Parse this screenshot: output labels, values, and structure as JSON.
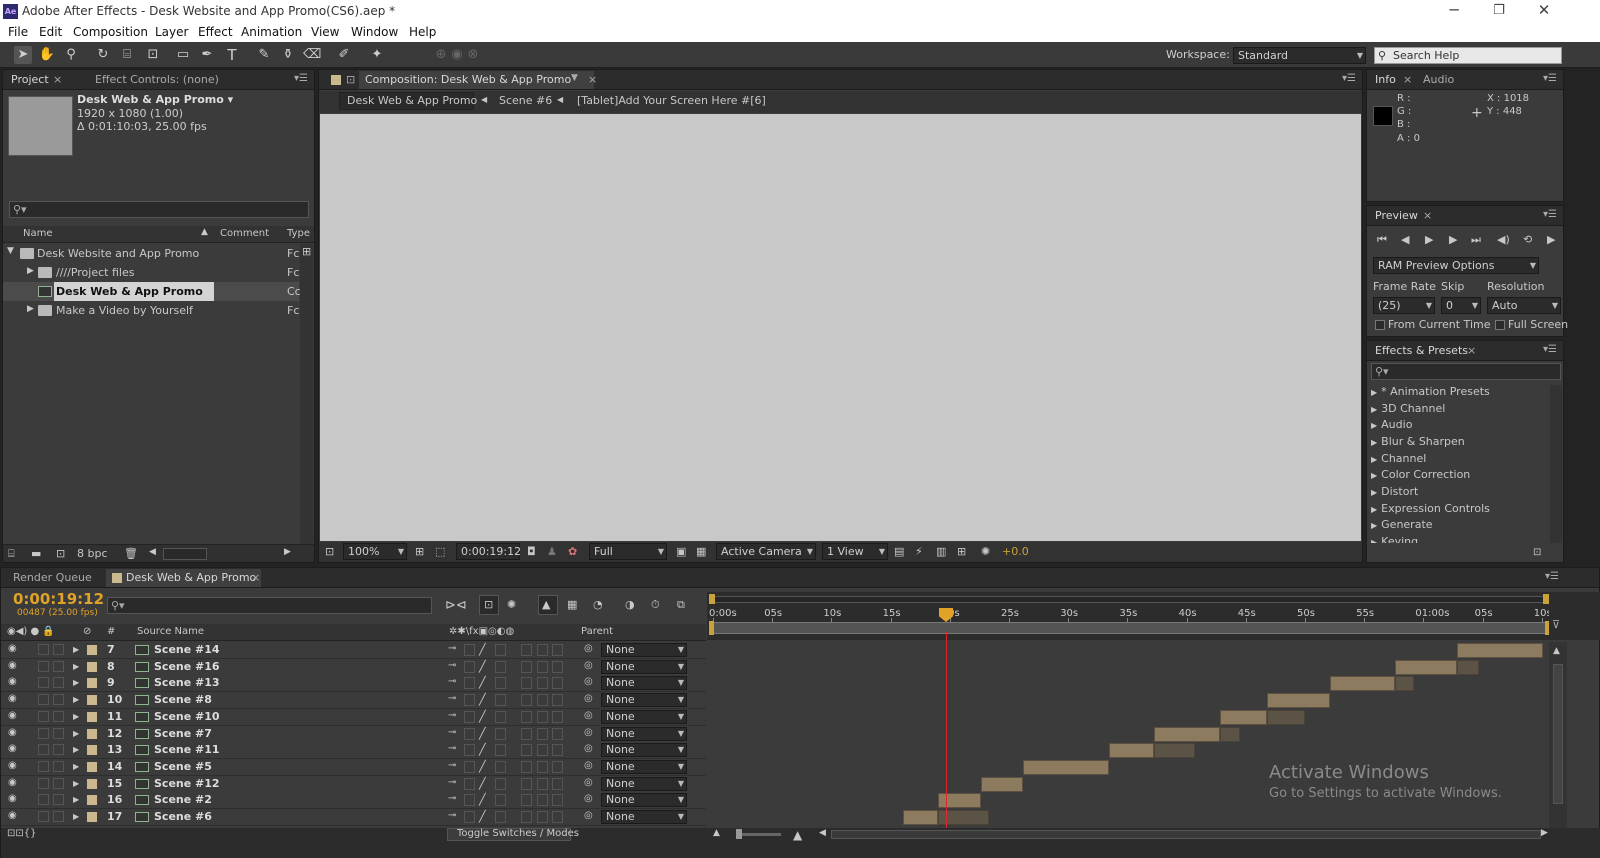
{
  "window": {
    "title": "Adobe After Effects - Desk Website and App Promo(CS6).aep *",
    "logo": "Ae",
    "minimize": "─",
    "maximize": "❐",
    "close": "✕"
  },
  "menu": [
    "File",
    "Edit",
    "Composition",
    "Layer",
    "Effect",
    "Animation",
    "View",
    "Window",
    "Help"
  ],
  "toolbar": {
    "workspace_label": "Workspace:",
    "workspace_value": "Standard",
    "search_help_placeholder": "Search Help"
  },
  "project": {
    "tab_project": "Project",
    "tab_effect_controls": "Effect Controls: (none)",
    "comp_name": "Desk Web & App Promo ▾",
    "comp_size": "1920 x 1080 (1.00)",
    "comp_duration": "Δ 0:01:10:03, 25.00 fps",
    "search_placeholder": "⚲▾",
    "col_name": "Name",
    "col_comment": "Comment",
    "col_type": "Type",
    "items": [
      {
        "name": "Desk Website and App Promo",
        "type": "Fc"
      },
      {
        "name": "////Project files",
        "type": "Fc"
      },
      {
        "name": "Desk Web & App Promo",
        "type": "Cc"
      },
      {
        "name": "Make a Video by Yourself",
        "type": "Fc"
      }
    ],
    "bpc": "8 bpc"
  },
  "composition": {
    "tab": "Composition: Desk Web & App Promo",
    "crumbs": [
      "Desk Web & App Promo",
      "Scene #6",
      "[Tablet]Add Your Screen Here #[6]"
    ],
    "zoom": "100%",
    "timecode": "0:00:19:12",
    "resolution": "Full",
    "camera": "Active Camera",
    "view": "1 View",
    "exposure": "+0.0",
    "viewer_color": "#c8c8c8"
  },
  "info": {
    "tab_info": "Info",
    "tab_audio": "Audio",
    "r": "R :",
    "g": "G :",
    "b": "B :",
    "a": "A : 0",
    "x": "X : 1018",
    "y": "Y : 448"
  },
  "preview": {
    "tab": "Preview",
    "ram": "RAM Preview Options",
    "frame_rate_label": "Frame Rate",
    "skip_label": "Skip",
    "resolution_label": "Resolution",
    "frame_rate": "(25)",
    "skip": "0",
    "resolution": "Auto",
    "from_current": "From Current Time",
    "full_screen": "Full Screen"
  },
  "effects": {
    "tab": "Effects & Presets",
    "search_placeholder": "⚲▾",
    "items": [
      "* Animation Presets",
      "3D Channel",
      "Audio",
      "Blur & Sharpen",
      "Channel",
      "Color Correction",
      "Distort",
      "Expression Controls",
      "Generate",
      "Keying"
    ]
  },
  "timeline": {
    "tab_render": "Render Queue",
    "tab_comp": "Desk Web & App Promo",
    "timecode": "0:00:19:12",
    "frames": "00487 (25.00 fps)",
    "search_placeholder": "⚲▾",
    "col_num": "#",
    "col_source": "Source Name",
    "col_parent": "Parent",
    "toggle": "Toggle Switches / Modes",
    "ruler": [
      "0:00s",
      "05s",
      "10s",
      "15s",
      "20s",
      "25s",
      "30s",
      "35s",
      "40s",
      "45s",
      "50s",
      "55s",
      "01:00s",
      "05s",
      "10s"
    ],
    "layers": [
      {
        "num": "7",
        "name": "Scene #14",
        "parent": "None"
      },
      {
        "num": "8",
        "name": "Scene #16",
        "parent": "None"
      },
      {
        "num": "9",
        "name": "Scene #13",
        "parent": "None"
      },
      {
        "num": "10",
        "name": "Scene #8",
        "parent": "None"
      },
      {
        "num": "11",
        "name": "Scene #10",
        "parent": "None"
      },
      {
        "num": "12",
        "name": "Scene #7",
        "parent": "None"
      },
      {
        "num": "13",
        "name": "Scene #11",
        "parent": "None"
      },
      {
        "num": "14",
        "name": "Scene #5",
        "parent": "None"
      },
      {
        "num": "15",
        "name": "Scene #12",
        "parent": "None"
      },
      {
        "num": "16",
        "name": "Scene #2",
        "parent": "None"
      },
      {
        "num": "17",
        "name": "Scene #6",
        "parent": "None"
      }
    ],
    "watermark_title": "Activate Windows",
    "watermark_sub": "Go to Settings to activate Windows."
  }
}
